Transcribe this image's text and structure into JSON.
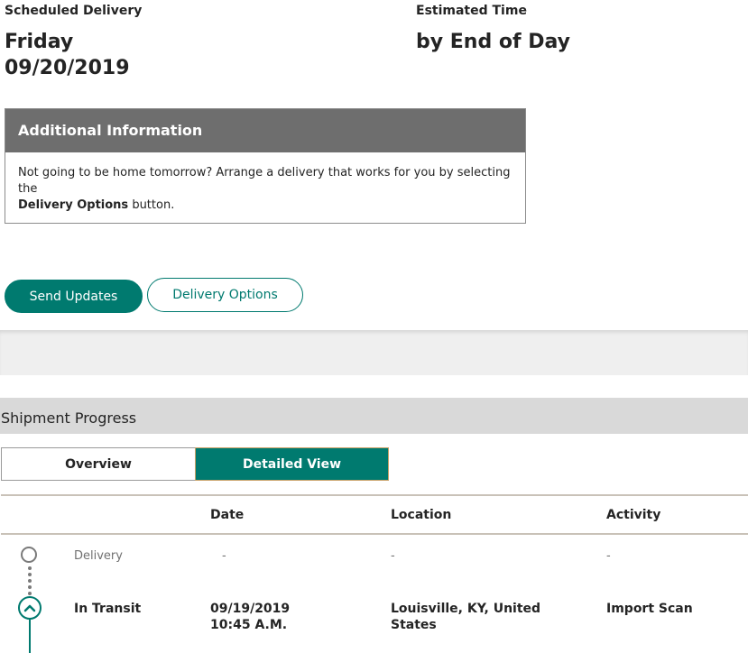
{
  "delivery": {
    "scheduled_label": "Scheduled Delivery",
    "day": "Friday",
    "date": "09/20/2019",
    "estimated_label": "Estimated Time",
    "estimated_value": "by End of Day"
  },
  "additional_info": {
    "title": "Additional Information",
    "text_prefix": "Not going to be home tomorrow? Arrange a delivery that works for you by selecting the",
    "text_bold": "Delivery Options",
    "text_suffix": " button."
  },
  "actions": {
    "send_updates": "Send Updates",
    "delivery_options": "Delivery Options"
  },
  "shipment_progress": {
    "title": "Shipment Progress",
    "tabs": [
      "Overview",
      "Detailed View"
    ],
    "active_tab": "Detailed View",
    "columns": [
      "Date",
      "Location",
      "Activity"
    ],
    "rows": [
      {
        "status": "Delivery",
        "date": "-",
        "location": "-",
        "activity": "-",
        "state": "upcoming"
      },
      {
        "status": "In Transit",
        "date_line1": "09/19/2019",
        "date_line2": "10:45 A.M.",
        "location_line1": "Louisville, KY, United",
        "location_line2": "States",
        "activity": "Import Scan",
        "state": "current"
      }
    ]
  },
  "colors": {
    "accent": "#007a6f",
    "info_header": "#6e6e6e",
    "progress_bar": "#d9d9d9",
    "band": "#efefef"
  }
}
